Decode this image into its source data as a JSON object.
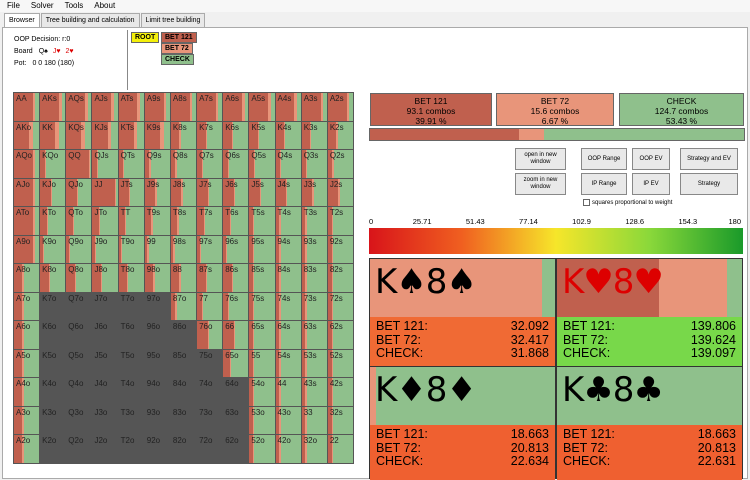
{
  "menu": [
    "File",
    "Solver",
    "Tools",
    "About"
  ],
  "tabs": [
    "Browser",
    "Tree building and calculation",
    "Limit tree building"
  ],
  "info": {
    "decision": "OOP Decision: r:0",
    "board_label": "Board",
    "board_cards": [
      {
        "t": "Q♠",
        "c": "sp"
      },
      {
        "t": "J♥",
        "c": "ht"
      },
      {
        "t": "2♥",
        "c": "ht"
      }
    ],
    "pot_label": "Pot:",
    "pot_value": "0 0 180 (180)"
  },
  "tree": {
    "root": "ROOT",
    "bet121": "BET 121",
    "bet72": "BET 72",
    "check": "CHECK"
  },
  "colors": {
    "bet121": "#c0604e",
    "bet72": "#e8957a",
    "check": "#8fc08c",
    "mixed_dark": "#555555"
  },
  "hands": [
    [
      "AA",
      "AKs",
      "AQs",
      "AJs",
      "ATs",
      "A9s",
      "A8s",
      "A7s",
      "A6s",
      "A5s",
      "A4s",
      "A3s",
      "A2s"
    ],
    [
      "AKo",
      "KK",
      "KQs",
      "KJs",
      "KTs",
      "K9s",
      "K8s",
      "K7s",
      "K6s",
      "K5s",
      "K4s",
      "K3s",
      "K2s"
    ],
    [
      "AQo",
      "KQo",
      "QQ",
      "QJs",
      "QTs",
      "Q9s",
      "Q8s",
      "Q7s",
      "Q6s",
      "Q5s",
      "Q4s",
      "Q3s",
      "Q2s"
    ],
    [
      "AJo",
      "KJo",
      "QJo",
      "JJ",
      "JTs",
      "J9s",
      "J8s",
      "J7s",
      "J6s",
      "J5s",
      "J4s",
      "J3s",
      "J2s"
    ],
    [
      "ATo",
      "KTo",
      "QTo",
      "JTo",
      "TT",
      "T9s",
      "T8s",
      "T7s",
      "T6s",
      "T5s",
      "T4s",
      "T3s",
      "T2s"
    ],
    [
      "A9o",
      "K9o",
      "Q9o",
      "J9o",
      "T9o",
      "99",
      "98s",
      "97s",
      "96s",
      "95s",
      "94s",
      "93s",
      "92s"
    ],
    [
      "A8o",
      "K8o",
      "Q8o",
      "J8o",
      "T8o",
      "98o",
      "88",
      "87s",
      "86s",
      "85s",
      "84s",
      "83s",
      "82s"
    ],
    [
      "A7o",
      "K7o",
      "Q7o",
      "J7o",
      "T7o",
      "97o",
      "87o",
      "77",
      "76s",
      "75s",
      "74s",
      "73s",
      "72s"
    ],
    [
      "A6o",
      "K6o",
      "Q6o",
      "J6o",
      "T6o",
      "96o",
      "86o",
      "76o",
      "66",
      "65s",
      "64s",
      "63s",
      "62s"
    ],
    [
      "A5o",
      "K5o",
      "Q5o",
      "J5o",
      "T5o",
      "95o",
      "85o",
      "75o",
      "65o",
      "55",
      "54s",
      "53s",
      "52s"
    ],
    [
      "A4o",
      "K4o",
      "Q4o",
      "J4o",
      "T4o",
      "94o",
      "84o",
      "74o",
      "64o",
      "54o",
      "44",
      "43s",
      "42s"
    ],
    [
      "A3o",
      "K3o",
      "Q3o",
      "J3o",
      "T3o",
      "93o",
      "83o",
      "73o",
      "63o",
      "53o",
      "43o",
      "33",
      "32s"
    ],
    [
      "A2o",
      "K2o",
      "Q2o",
      "J2o",
      "T2o",
      "92o",
      "82o",
      "72o",
      "62o",
      "52o",
      "42o",
      "32o",
      "22"
    ]
  ],
  "summary": [
    {
      "name": "BET 121",
      "combos": "93.1 combos",
      "pct": "39.91 %",
      "color": "#c0604e"
    },
    {
      "name": "BET 72",
      "combos": "15.6 combos",
      "pct": "6.67 %",
      "color": "#e8957a"
    },
    {
      "name": "CHECK",
      "combos": "124.7 combos",
      "pct": "53.43 %",
      "color": "#8fc08c"
    }
  ],
  "overall_freq": {
    "bet121": 0.3991,
    "bet72": 0.0667,
    "check": 0.5343
  },
  "buttons": {
    "open_new": "open in new window",
    "zoom_new": "zoom in new window",
    "oop_range": "OOP Range",
    "oop_ev": "OOP EV",
    "strat_ev": "Strategy and EV",
    "ip_range": "IP Range",
    "ip_ev": "IP EV",
    "strategy": "Strategy",
    "squares": "squares proportional to weight"
  },
  "scale": [
    "0",
    "25.71",
    "51.43",
    "77.14",
    "102.9",
    "128.6",
    "154.3",
    "180"
  ],
  "combos": [
    {
      "cards": [
        {
          "t": "K♠",
          "c": "sp"
        },
        {
          "t": "8♠",
          "c": "sp"
        }
      ],
      "mix": {
        "bet121": 0,
        "bet72": 0.93,
        "check": 0.07
      },
      "ev": [
        {
          "k": "BET 121:",
          "v": "32.092"
        },
        {
          "k": "BET 72:",
          "v": "32.417"
        },
        {
          "k": "CHECK:",
          "v": "31.868"
        }
      ],
      "evcolor": "#f06a34"
    },
    {
      "cards": [
        {
          "t": "K♥",
          "c": "ht"
        },
        {
          "t": "8♥",
          "c": "ht"
        }
      ],
      "mix": {
        "bet121": 0.55,
        "bet72": 0.37,
        "check": 0.08
      },
      "ev": [
        {
          "k": "BET 121:",
          "v": "139.806"
        },
        {
          "k": "BET 72:",
          "v": "139.624"
        },
        {
          "k": "CHECK:",
          "v": "139.097"
        }
      ],
      "evcolor": "#78d84a"
    },
    {
      "cards": [
        {
          "t": "K♦",
          "c": "sp"
        },
        {
          "t": "8♦",
          "c": "sp"
        }
      ],
      "mix": {
        "bet121": 0,
        "bet72": 0.03,
        "check": 0.97
      },
      "ev": [
        {
          "k": "BET 121:",
          "v": "18.663"
        },
        {
          "k": "BET 72:",
          "v": "20.813"
        },
        {
          "k": "CHECK:",
          "v": "22.634"
        }
      ],
      "evcolor": "#ef6030"
    },
    {
      "cards": [
        {
          "t": "K♣",
          "c": "sp"
        },
        {
          "t": "8♣",
          "c": "sp"
        }
      ],
      "mix": {
        "bet121": 0,
        "bet72": 0,
        "check": 1
      },
      "ev": [
        {
          "k": "BET 121:",
          "v": "18.663"
        },
        {
          "k": "BET 72:",
          "v": "20.813"
        },
        {
          "k": "CHECK:",
          "v": "22.631"
        }
      ],
      "evcolor": "#ef6030"
    }
  ]
}
